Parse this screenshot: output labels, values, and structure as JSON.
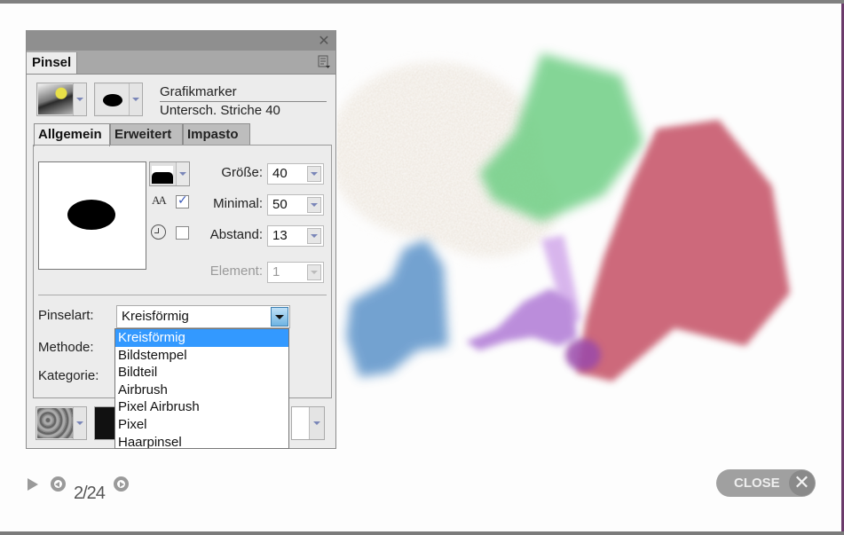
{
  "panel": {
    "close_icon": "close-icon",
    "tab_label": "Pinsel",
    "menu_icon": "panel-menu-icon",
    "brush_name_line1": "Grafikmarker",
    "brush_name_line2": "Untersch. Striche 40",
    "subtabs": [
      {
        "label": "Allgemein",
        "active": true
      },
      {
        "label": "Erweitert",
        "active": false
      },
      {
        "label": "Impasto",
        "active": false
      }
    ],
    "fields": {
      "groesse": {
        "label": "Größe:",
        "value": "40"
      },
      "minimal": {
        "label": "Minimal:",
        "value": "50"
      },
      "abstand": {
        "label": "Abstand:",
        "value": "13"
      },
      "element": {
        "label": "Element:",
        "value": "1",
        "disabled": true
      }
    },
    "antialias_icon_text": "AA",
    "antialias_checked": true,
    "timer_checked": false,
    "pinselart": {
      "label": "Pinselart:",
      "value": "Kreisförmig",
      "options": [
        "Kreisförmig",
        "Bildstempel",
        "Bildteil",
        "Airbrush",
        "Pixel Airbrush",
        "Pixel",
        "Haarpinsel"
      ],
      "selected_index": 0
    },
    "methode_label": "Methode:",
    "kategorie_label": "Kategorie:"
  },
  "lightbox": {
    "counter": "2/24",
    "close_label": "CLOSE",
    "close_glyph": "✕"
  },
  "artwork_colors": {
    "sand": "#c9b49a",
    "green": "#6fcf85",
    "blue": "#5b93c9",
    "purple": "#b07ad6",
    "red": "#c85a6d"
  }
}
